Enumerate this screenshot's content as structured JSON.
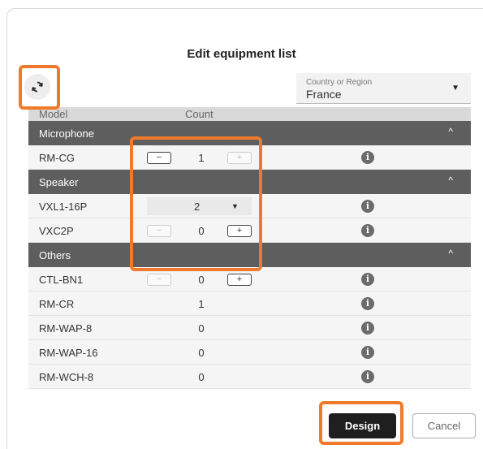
{
  "dialog": {
    "title": "Edit equipment list",
    "refresh_icon": "refresh-icon",
    "country": {
      "label": "Country or Region",
      "value": "France"
    },
    "columns": {
      "model": "Model",
      "count": "Count"
    }
  },
  "categories": [
    {
      "name": "Microphone",
      "rows": [
        {
          "model": "RM-CG",
          "count": "1",
          "minus_enabled": true,
          "plus_enabled": false
        }
      ]
    },
    {
      "name": "Speaker",
      "rows": [
        {
          "model": "VXL1-16P",
          "count": "2",
          "select": true
        },
        {
          "model": "VXC2P",
          "count": "0",
          "minus_enabled": false,
          "plus_enabled": true
        }
      ]
    },
    {
      "name": "Others",
      "rows": [
        {
          "model": "CTL-BN1",
          "count": "0",
          "minus_enabled": false,
          "plus_enabled": true
        },
        {
          "model": "RM-CR",
          "count": "1"
        },
        {
          "model": "RM-WAP-8",
          "count": "0"
        },
        {
          "model": "RM-WAP-16",
          "count": "0"
        },
        {
          "model": "RM-WCH-8",
          "count": "0"
        }
      ]
    }
  ],
  "stepper": {
    "minus": "−",
    "plus": "+"
  },
  "info_glyph": "i",
  "chevron_glyph": "^",
  "buttons": {
    "design": "Design",
    "cancel": "Cancel"
  },
  "colors": {
    "highlight": "#f07a2c",
    "category_bg": "#5e5e5e",
    "design_bg": "#1f1f1f"
  }
}
